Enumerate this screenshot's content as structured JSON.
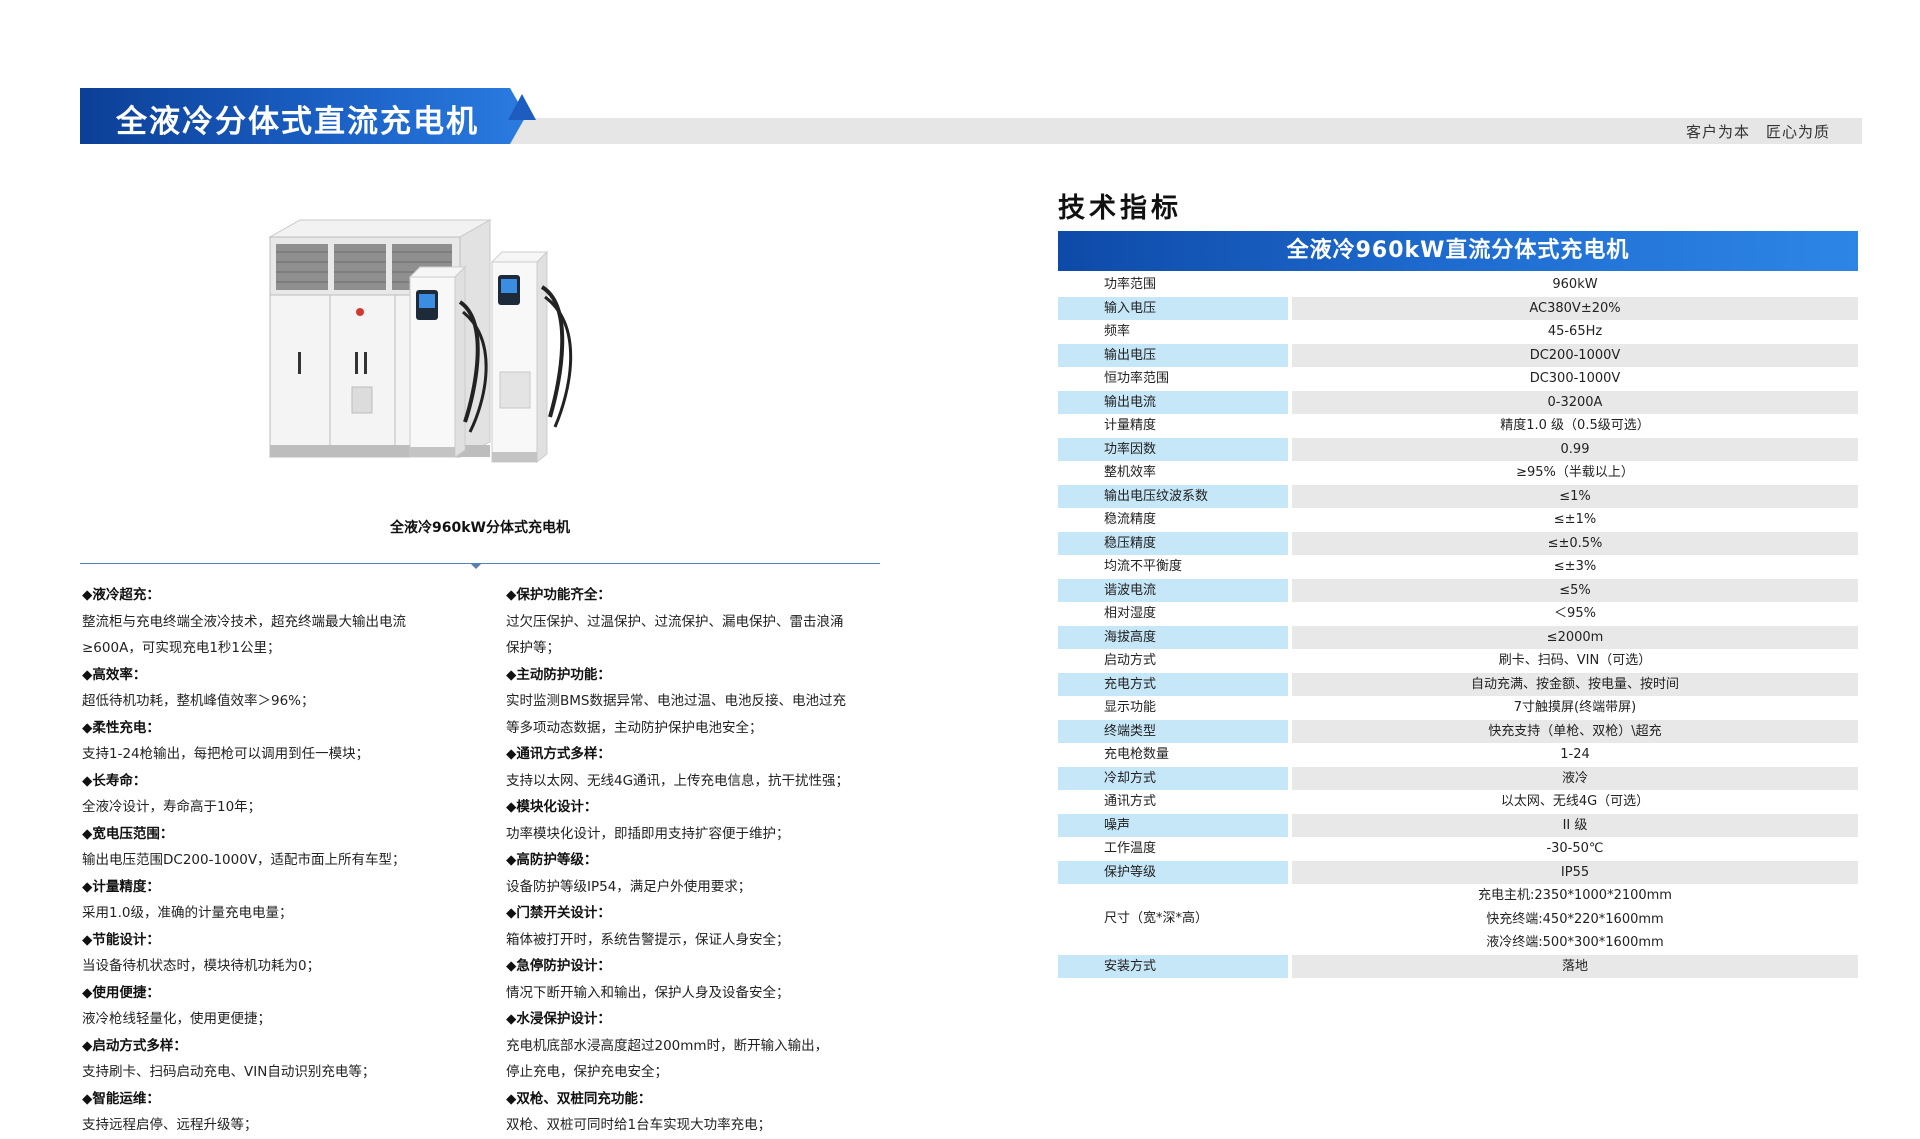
{
  "header": {
    "title": "全液冷分体式直流充电机",
    "slogan": "客户为本　匠心为质"
  },
  "product": {
    "caption": "全液冷960kW分体式充电机"
  },
  "features_left": [
    {
      "head": "◆液冷超充：",
      "lines": [
        "整流柜与充电终端全液冷技术，超充终端最大输出电流",
        "≥600A，可实现充电1秒1公里；"
      ]
    },
    {
      "head": "◆高效率：",
      "lines": [
        "超低待机功耗，整机峰值效率＞96%；"
      ]
    },
    {
      "head": "◆柔性充电：",
      "lines": [
        "支持1-24枪输出，每把枪可以调用到任一模块；"
      ]
    },
    {
      "head": "◆长寿命：",
      "lines": [
        "全液冷设计，寿命高于10年；"
      ]
    },
    {
      "head": "◆宽电压范围：",
      "lines": [
        "输出电压范围DC200-1000V，适配市面上所有车型；"
      ]
    },
    {
      "head": "◆计量精度：",
      "lines": [
        "采用1.0级，准确的计量充电电量；"
      ]
    },
    {
      "head": "◆节能设计：",
      "lines": [
        "当设备待机状态时，模块待机功耗为0；"
      ]
    },
    {
      "head": "◆使用便捷：",
      "lines": [
        "液冷枪线轻量化，使用更便捷；"
      ]
    },
    {
      "head": "◆启动方式多样：",
      "lines": [
        "支持刷卡、扫码启动充电、VIN自动识别充电等；"
      ]
    },
    {
      "head": "◆智能运维：",
      "lines": [
        "支持远程启停、远程升级等；"
      ]
    }
  ],
  "features_right": [
    {
      "head": "◆保护功能齐全：",
      "lines": [
        "过欠压保护、过温保护、过流保护、漏电保护、雷击浪涌",
        "保护等；"
      ]
    },
    {
      "head": "◆主动防护功能：",
      "lines": [
        "实时监测BMS数据异常、电池过温、电池反接、电池过充",
        "等多项动态数据，主动防护保护电池安全；"
      ]
    },
    {
      "head": "◆通讯方式多样：",
      "lines": [
        "支持以太网、无线4G通讯，上传充电信息，抗干扰性强；"
      ]
    },
    {
      "head": "◆模块化设计：",
      "lines": [
        "功率模块化设计，即插即用支持扩容便于维护；"
      ]
    },
    {
      "head": "◆高防护等级：",
      "lines": [
        "设备防护等级IP54，满足户外使用要求；"
      ]
    },
    {
      "head": "◆门禁开关设计：",
      "lines": [
        "箱体被打开时，系统告警提示，保证人身安全；"
      ]
    },
    {
      "head": "◆急停防护设计：",
      "lines": [
        "情况下断开输入和输出，保护人身及设备安全；"
      ]
    },
    {
      "head": "◆水浸保护设计：",
      "lines": [
        "充电机底部水浸高度超过200mm时，断开输入输出，",
        "停止充电，保护充电安全；"
      ]
    },
    {
      "head": "◆双枪、双桩同充功能：",
      "lines": [
        "双枪、双桩可同时给1台车实现大功率充电；"
      ]
    }
  ],
  "specs": {
    "heading": "技术指标",
    "table_title": "全液冷960kW直流分体式充电机",
    "rows": [
      {
        "label": "功率范围",
        "value": "960kW"
      },
      {
        "label": "输入电压",
        "value": "AC380V±20%"
      },
      {
        "label": "频率",
        "value": "45-65Hz"
      },
      {
        "label": "输出电压",
        "value": "DC200-1000V"
      },
      {
        "label": "恒功率范围",
        "value": "DC300-1000V"
      },
      {
        "label": "输出电流",
        "value": "0-3200A"
      },
      {
        "label": "计量精度",
        "value": "精度1.0 级（0.5级可选）"
      },
      {
        "label": "功率因数",
        "value": "0.99"
      },
      {
        "label": "整机效率",
        "value": "≥95%（半载以上）"
      },
      {
        "label": "输出电压纹波系数",
        "value": "≤1%"
      },
      {
        "label": "稳流精度",
        "value": "≤±1%"
      },
      {
        "label": "稳压精度",
        "value": "≤±0.5%"
      },
      {
        "label": "均流不平衡度",
        "value": "≤±3%"
      },
      {
        "label": "谐波电流",
        "value": "≤5%"
      },
      {
        "label": "相对湿度",
        "value": "＜95%"
      },
      {
        "label": "海拔高度",
        "value": "≤2000m"
      },
      {
        "label": "启动方式",
        "value": "刷卡、扫码、VIN（可选）"
      },
      {
        "label": "充电方式",
        "value": "自动充满、按金额、按电量、按时间"
      },
      {
        "label": "显示功能",
        "value": "7寸触摸屏(终端带屏)"
      },
      {
        "label": "终端类型",
        "value": "快充支持（单枪、双枪）\\超充"
      },
      {
        "label": "充电枪数量",
        "value": "1-24"
      },
      {
        "label": "冷却方式",
        "value": "液冷"
      },
      {
        "label": "通讯方式",
        "value": "以太网、无线4G（可选）"
      },
      {
        "label": "噪声",
        "value": "II 级"
      },
      {
        "label": "工作温度",
        "value": "-30-50℃"
      },
      {
        "label": "保护等级",
        "value": "IP55"
      }
    ],
    "size_row": {
      "label": "尺寸（宽*深*高）",
      "values": [
        "充电主机:2350*1000*2100mm",
        "快充终端:450*220*1600mm",
        "液冷终端:500*300*1600mm"
      ]
    },
    "install_row": {
      "label": "安装方式",
      "value": "落地"
    }
  }
}
